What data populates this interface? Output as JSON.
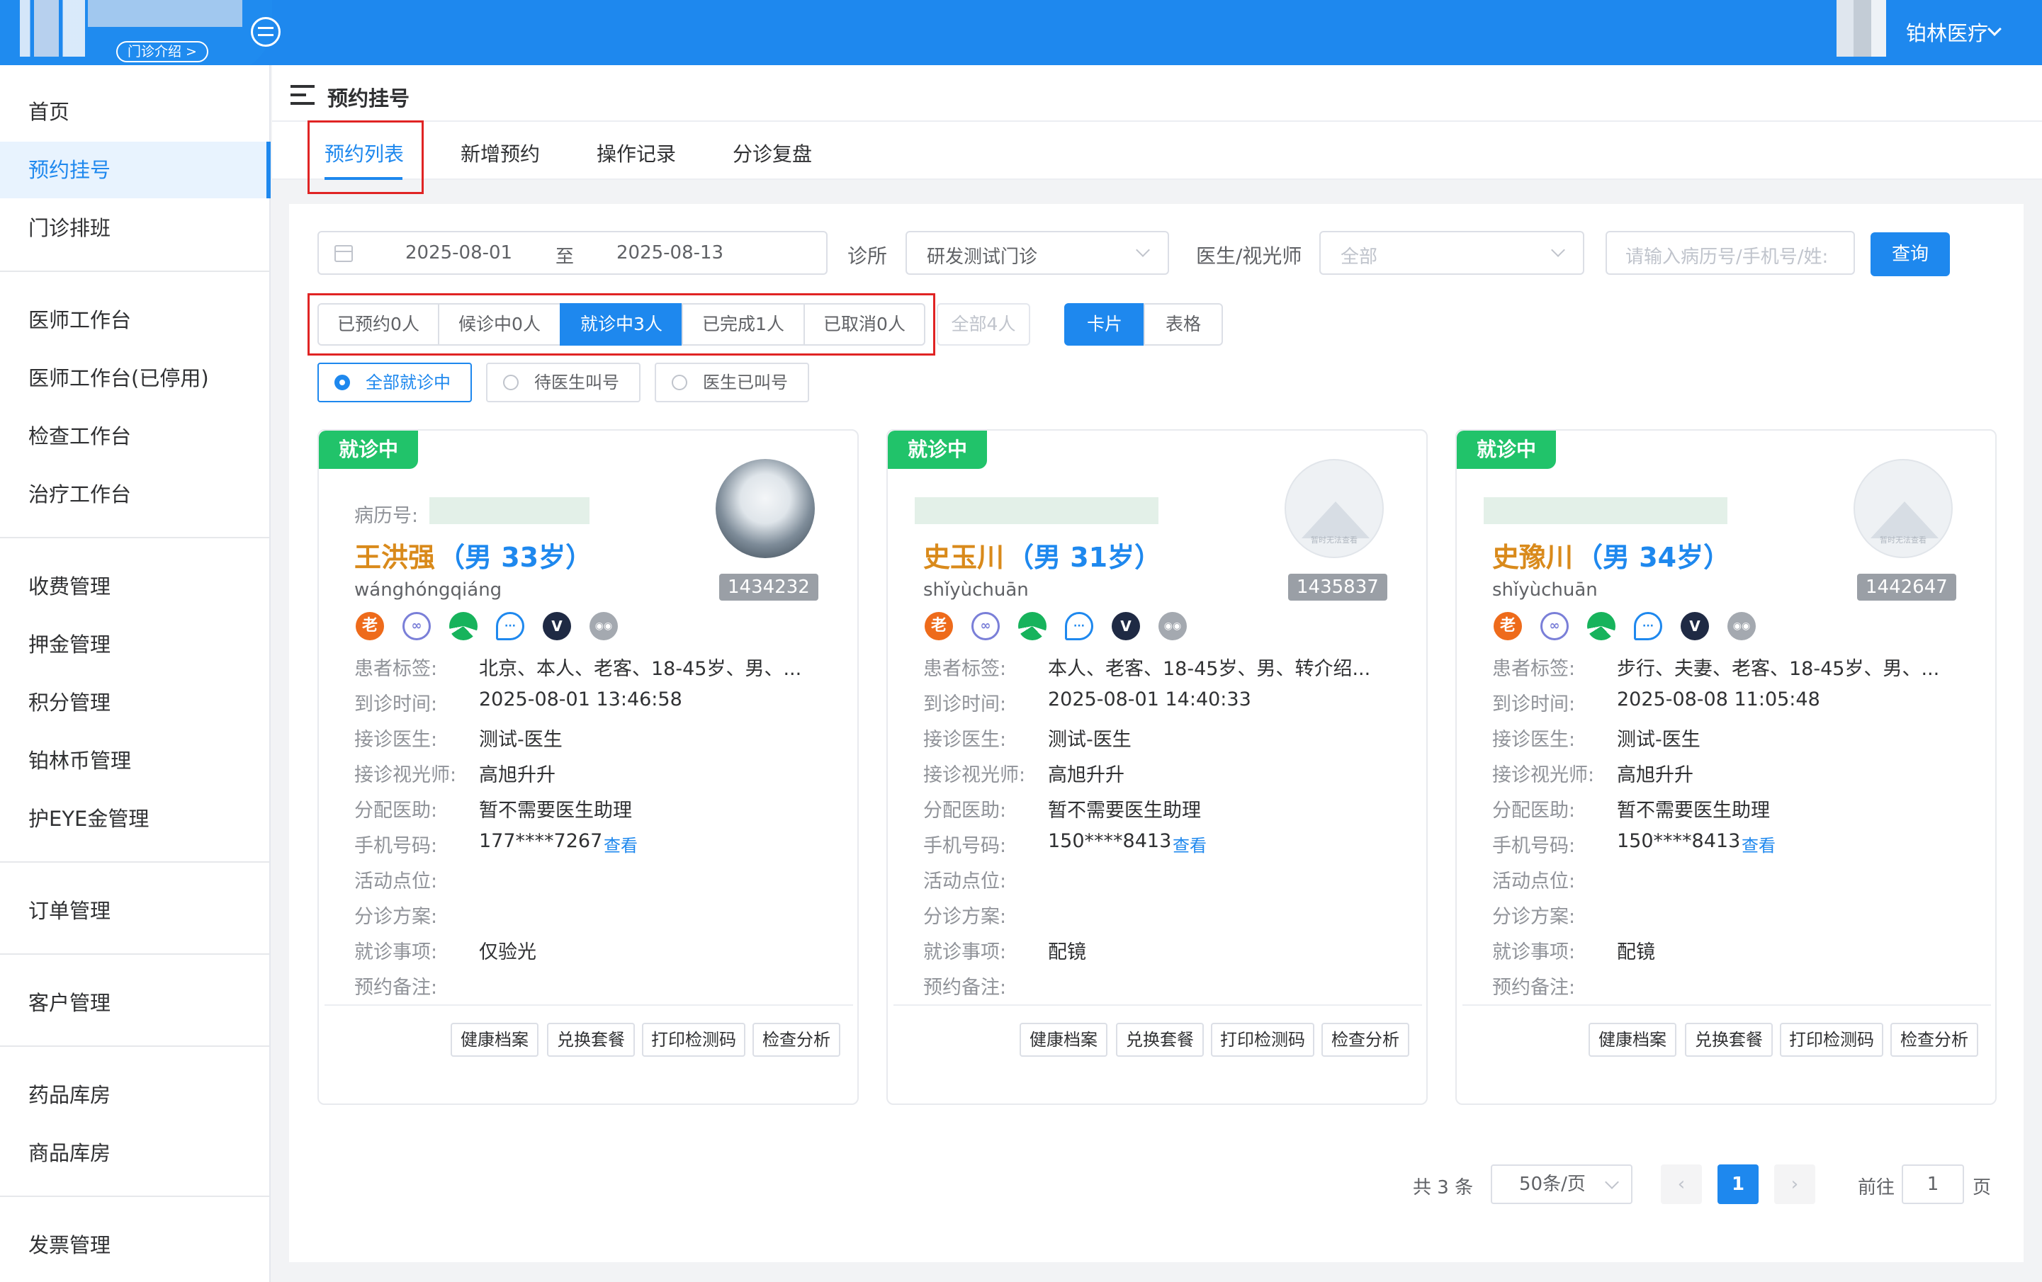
{
  "header": {
    "clinic_intro_label": "门诊介绍 >",
    "user_name": "铂林医疗"
  },
  "sidebar": {
    "items": [
      {
        "label": "首页"
      },
      {
        "label": "预约挂号"
      },
      {
        "label": "门诊排班"
      },
      {
        "label": "医师工作台"
      },
      {
        "label": "医师工作台(已停用)"
      },
      {
        "label": "检查工作台"
      },
      {
        "label": "治疗工作台"
      },
      {
        "label": "收费管理"
      },
      {
        "label": "押金管理"
      },
      {
        "label": "积分管理"
      },
      {
        "label": "铂林币管理"
      },
      {
        "label": "护EYE金管理"
      },
      {
        "label": "订单管理"
      },
      {
        "label": "客户管理"
      },
      {
        "label": "药品库房"
      },
      {
        "label": "商品库房"
      },
      {
        "label": "发票管理"
      }
    ]
  },
  "page": {
    "title": "预约挂号",
    "tabs": [
      {
        "label": "预约列表"
      },
      {
        "label": "新增预约"
      },
      {
        "label": "操作记录"
      },
      {
        "label": "分诊复盘"
      }
    ]
  },
  "filters": {
    "date_start": "2025-08-01",
    "date_separator": "至",
    "date_end": "2025-08-13",
    "clinic_label": "诊所",
    "clinic_value": "研发测试门诊",
    "doctor_label": "医生/视光师",
    "doctor_value": "全部",
    "search_placeholder": "请输入病历号/手机号/姓:",
    "query_button": "查询"
  },
  "status_tabs": [
    {
      "label": "已预约0人"
    },
    {
      "label": "候诊中0人"
    },
    {
      "label": "就诊中3人"
    },
    {
      "label": "已完成1人"
    },
    {
      "label": "已取消0人"
    },
    {
      "label": "全部4人"
    }
  ],
  "view_toggle": {
    "card": "卡片",
    "table": "表格"
  },
  "sub_filters": [
    {
      "label": "全部就诊中"
    },
    {
      "label": "待医生叫号"
    },
    {
      "label": "医生已叫号"
    }
  ],
  "field_labels": {
    "mrn": "病历号:",
    "tags": "患者标签:",
    "arrival": "到诊时间:",
    "doctor": "接诊医生:",
    "optometrist": "接诊视光师:",
    "assistant": "分配医助:",
    "phone": "手机号码:",
    "activity": "活动点位:",
    "triage": "分诊方案:",
    "matter": "就诊事项:",
    "remark": "预约备注:",
    "view_link": "查看",
    "avatar_placeholder": "暂时无法查看"
  },
  "card_status": "就诊中",
  "card_icon_old": "老",
  "card_buttons": [
    "健康档案",
    "兑换套餐",
    "打印检测码",
    "检查分析"
  ],
  "patients": [
    {
      "name": "王洪强",
      "gender_age": "（男 33岁）",
      "pinyin": "wánghóngqiáng",
      "id": "1434232",
      "tags": "北京、本人、老客、18-45岁、男、...",
      "arrival": "2025-08-01 13:46:58",
      "doctor": "测试-医生",
      "optometrist": "高旭升升",
      "assistant": "暂不需要医生助理",
      "phone": "177****7267",
      "matter": "仅验光"
    },
    {
      "name": "史玉川",
      "gender_age": "（男 31岁）",
      "pinyin": "shǐyùchuān",
      "id": "1435837",
      "tags": "本人、老客、18-45岁、男、转介绍...",
      "arrival": "2025-08-01 14:40:33",
      "doctor": "测试-医生",
      "optometrist": "高旭升升",
      "assistant": "暂不需要医生助理",
      "phone": "150****8413",
      "matter": "配镜"
    },
    {
      "name": "史豫川",
      "gender_age": "（男 34岁）",
      "pinyin": "shǐyùchuān",
      "id": "1442647",
      "tags": "步行、夫妻、老客、18-45岁、男、...",
      "arrival": "2025-08-08 11:05:48",
      "doctor": "测试-医生",
      "optometrist": "高旭升升",
      "assistant": "暂不需要医生助理",
      "phone": "150****8413",
      "matter": "配镜"
    }
  ],
  "pagination": {
    "total": "共 3 条",
    "page_size": "50条/页",
    "current_page": "1",
    "goto_label": "前往",
    "goto_value": "1",
    "page_suffix": "页"
  }
}
